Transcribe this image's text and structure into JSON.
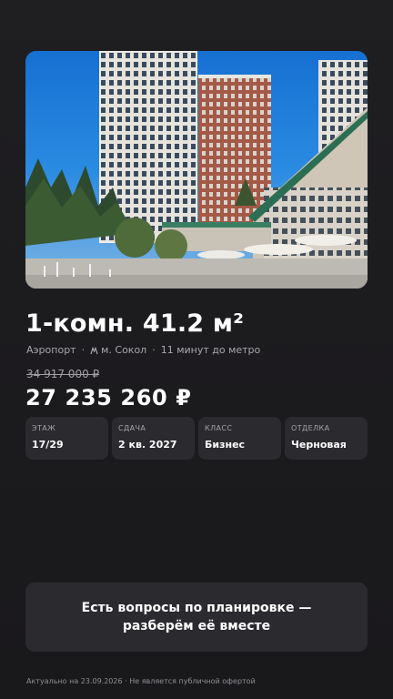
{
  "listing": {
    "title": "1-комн. 41.2 м²",
    "district": "Аэропорт",
    "metro": "м. Сокол",
    "metro_distance": "11 минут до метро",
    "old_price": "34 917 000 ₽",
    "price": "27 235 260 ₽"
  },
  "specs": [
    {
      "label": "ЭТАЖ",
      "value": "17/29"
    },
    {
      "label": "СДАЧА",
      "value": "2 кв. 2027"
    },
    {
      "label": "КЛАСС",
      "value": "Бизнес"
    },
    {
      "label": "ОТДЕЛКА",
      "value": "Черновая"
    }
  ],
  "cta": {
    "label": "Есть вопросы по планировке — разберём её вместе"
  },
  "footer": {
    "note": "Актуально на 23.09.2026 · Не является публичной офертой"
  },
  "colors": {
    "background": "#1c1b1e",
    "card": "#2b2a2f",
    "text": "#ffffff",
    "muted": "#a9a8ad"
  }
}
